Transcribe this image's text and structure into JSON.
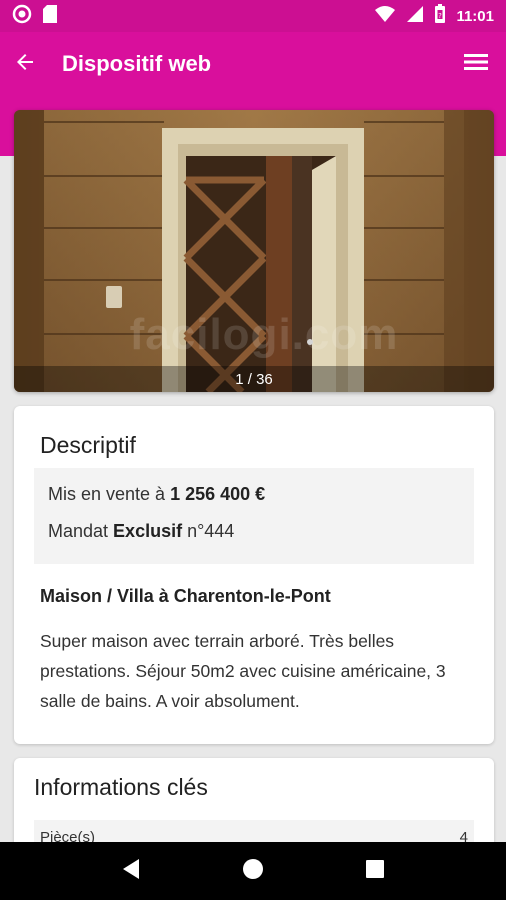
{
  "status_bar": {
    "time": "11:01",
    "icons": [
      "notification-icon",
      "sd-card-icon",
      "wifi-icon",
      "signal-icon",
      "battery-icon"
    ]
  },
  "app_bar": {
    "title": "Dispositif web",
    "back_icon": "arrow-left-icon",
    "menu_icon": "menu-icon"
  },
  "gallery": {
    "watermark": "facilogi.com",
    "counter": "1 / 36"
  },
  "description": {
    "heading": "Descriptif",
    "price_prefix": "Mis en vente à ",
    "price": "1 256 400 €",
    "mandate_prefix": "Mandat ",
    "mandate_type": "Exclusif",
    "mandate_number": " n°444",
    "property_title": "Maison / Villa à Charenton-le-Pont",
    "property_text": "Super maison avec terrain arboré. Très belles prestations. Séjour 50m2 avec cuisine américaine, 3 salle de bains. A voir absolument."
  },
  "key_info": {
    "heading": "Informations clés",
    "rows": [
      {
        "label": "Pièce(s)",
        "value": "4"
      }
    ]
  },
  "nav_bar": {
    "icons": [
      "back-triangle-icon",
      "home-circle-icon",
      "recents-square-icon"
    ]
  },
  "colors": {
    "brand": "#d90f9c",
    "status_bar": "#cc0f92"
  }
}
